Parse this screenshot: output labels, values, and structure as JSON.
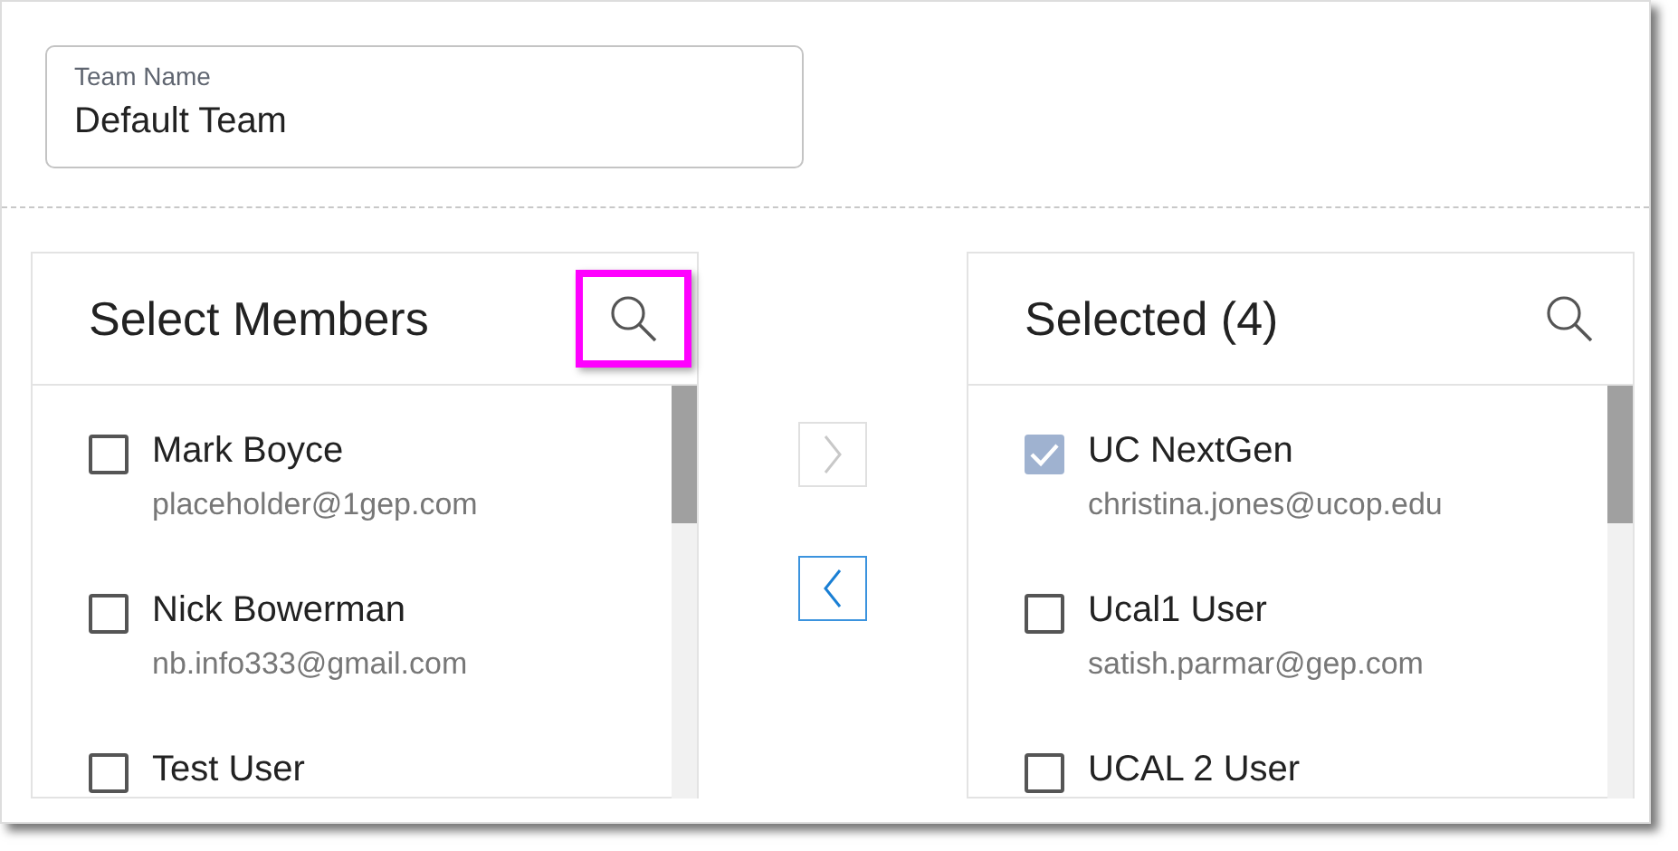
{
  "team_name": {
    "label": "Team Name",
    "value": "Default Team"
  },
  "panels": [
    {
      "title": "Select Members",
      "search_highlighted": true,
      "items": [
        {
          "name": "Mark Boyce",
          "email": "placeholder@1gep.com",
          "checked": false,
          "disabled": false
        },
        {
          "name": "Nick Bowerman",
          "email": "nb.info333@gmail.com",
          "checked": false,
          "disabled": false
        },
        {
          "name": "Test User",
          "checked": false,
          "disabled": false
        }
      ]
    },
    {
      "title": "Selected (4)",
      "search_highlighted": false,
      "items": [
        {
          "name": "UC NextGen",
          "email": "christina.jones@ucop.edu",
          "checked": true,
          "disabled": true
        },
        {
          "name": "Ucal1 User",
          "email": "satish.parmar@gep.com",
          "checked": false,
          "disabled": false
        },
        {
          "name": "UCAL 2 User",
          "checked": false,
          "disabled": false
        }
      ]
    }
  ],
  "transfer_buttons": [
    {
      "kind": "right",
      "disabled": true
    },
    {
      "kind": "left",
      "disabled": false
    }
  ]
}
